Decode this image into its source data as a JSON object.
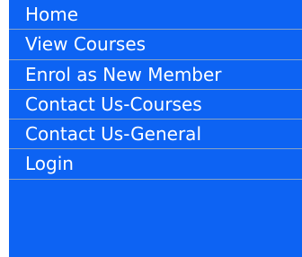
{
  "nav": {
    "items": [
      {
        "label": "Home"
      },
      {
        "label": "View Courses"
      },
      {
        "label": "Enrol as New Member"
      },
      {
        "label": "Contact Us-Courses"
      },
      {
        "label": "Contact Us-General"
      },
      {
        "label": "Login"
      }
    ]
  },
  "colors": {
    "background": "#0d63f3",
    "text": "#ffffff",
    "divider": "#8ba3c2"
  }
}
